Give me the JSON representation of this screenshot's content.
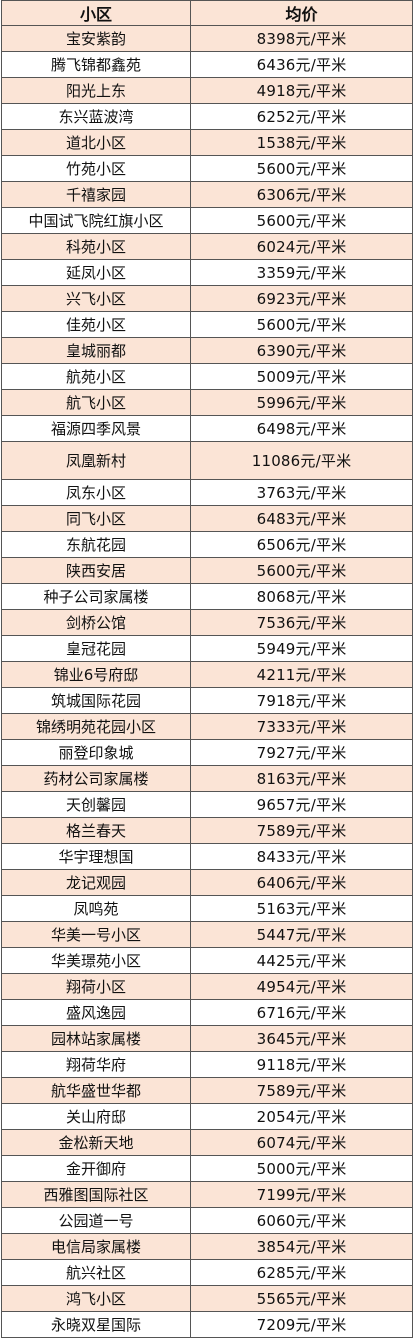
{
  "table": {
    "headers": [
      "小区",
      "均价"
    ],
    "rows": [
      {
        "name": "宝安紫韵",
        "price": "8398元/平米"
      },
      {
        "name": "腾飞锦都鑫苑",
        "price": "6436元/平米"
      },
      {
        "name": "阳光上东",
        "price": "4918元/平米"
      },
      {
        "name": "东兴蓝波湾",
        "price": "6252元/平米"
      },
      {
        "name": "道北小区",
        "price": "1538元/平米"
      },
      {
        "name": "竹苑小区",
        "price": "5600元/平米"
      },
      {
        "name": "千禧家园",
        "price": "6306元/平米"
      },
      {
        "name": "中国试飞院红旗小区",
        "price": "5600元/平米"
      },
      {
        "name": "科苑小区",
        "price": "6024元/平米"
      },
      {
        "name": "延凤小区",
        "price": "3359元/平米"
      },
      {
        "name": "兴飞小区",
        "price": "6923元/平米"
      },
      {
        "name": "佳苑小区",
        "price": "5600元/平米"
      },
      {
        "name": "皇城丽都",
        "price": "6390元/平米"
      },
      {
        "name": "航苑小区",
        "price": "5009元/平米"
      },
      {
        "name": "航飞小区",
        "price": "5996元/平米"
      },
      {
        "name": "福源四季风景",
        "price": "6498元/平米"
      },
      {
        "name": "凤凰新村",
        "price": "11086元/平米"
      },
      {
        "name": "凤东小区",
        "price": "3763元/平米"
      },
      {
        "name": "同飞小区",
        "price": "6483元/平米"
      },
      {
        "name": "东航花园",
        "price": "6506元/平米"
      },
      {
        "name": "陕西安居",
        "price": "5600元/平米"
      },
      {
        "name": "种子公司家属楼",
        "price": "8068元/平米"
      },
      {
        "name": "剑桥公馆",
        "price": "7536元/平米"
      },
      {
        "name": "皇冠花园",
        "price": "5949元/平米"
      },
      {
        "name": "锦业6号府邸",
        "price": "4211元/平米"
      },
      {
        "name": "筑城国际花园",
        "price": "7918元/平米"
      },
      {
        "name": "锦绣明苑花园小区",
        "price": "7333元/平米"
      },
      {
        "name": "丽登印象城",
        "price": "7927元/平米"
      },
      {
        "name": "药材公司家属楼",
        "price": "8163元/平米"
      },
      {
        "name": "天创馨园",
        "price": "9657元/平米"
      },
      {
        "name": "格兰春天",
        "price": "7589元/平米"
      },
      {
        "name": "华宇理想国",
        "price": "8433元/平米"
      },
      {
        "name": "龙记观园",
        "price": "6406元/平米"
      },
      {
        "name": "凤鸣苑",
        "price": "5163元/平米"
      },
      {
        "name": "华美一号小区",
        "price": "5447元/平米"
      },
      {
        "name": "华美璟苑小区",
        "price": "4425元/平米"
      },
      {
        "name": "翔荷小区",
        "price": "4954元/平米"
      },
      {
        "name": "盛风逸园",
        "price": "6716元/平米"
      },
      {
        "name": "园林站家属楼",
        "price": "3645元/平米"
      },
      {
        "name": "翔荷华府",
        "price": "9118元/平米"
      },
      {
        "name": "航华盛世华都",
        "price": "7589元/平米"
      },
      {
        "name": "关山府邸",
        "price": "2054元/平米"
      },
      {
        "name": "金松新天地",
        "price": "6074元/平米"
      },
      {
        "name": "金开御府",
        "price": "5000元/平米"
      },
      {
        "name": "西雅图国际社区",
        "price": "7199元/平米"
      },
      {
        "name": "公园道一号",
        "price": "6060元/平米"
      },
      {
        "name": "电信局家属楼",
        "price": "3854元/平米"
      },
      {
        "name": "航兴社区",
        "price": "6285元/平米"
      },
      {
        "name": "鸿飞小区",
        "price": "5565元/平米"
      },
      {
        "name": "永晓双星国际",
        "price": "7209元/平米"
      }
    ]
  },
  "colors": {
    "header_bg": "#fbe4d6",
    "row_odd_bg": "#fbe4d6",
    "row_even_bg": "#ffffff",
    "border": "#555555"
  }
}
